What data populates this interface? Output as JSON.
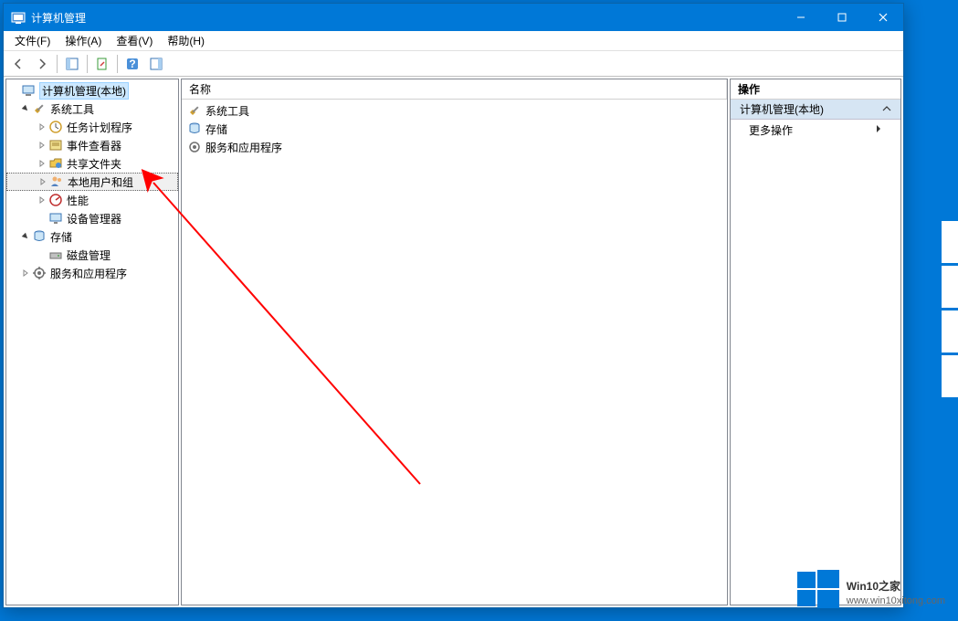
{
  "window": {
    "title": "计算机管理"
  },
  "menus": [
    "文件(F)",
    "操作(A)",
    "查看(V)",
    "帮助(H)"
  ],
  "tree": {
    "root": "计算机管理(本地)",
    "system_tools": {
      "label": "系统工具",
      "children": [
        "任务计划程序",
        "事件查看器",
        "共享文件夹",
        "本地用户和组",
        "性能",
        "设备管理器"
      ]
    },
    "storage": {
      "label": "存储",
      "children": [
        "磁盘管理"
      ]
    },
    "services": "服务和应用程序"
  },
  "center": {
    "header": "名称",
    "items": [
      "系统工具",
      "存储",
      "服务和应用程序"
    ]
  },
  "actions": {
    "header": "操作",
    "group": "计算机管理(本地)",
    "more": "更多操作"
  },
  "watermark": {
    "brand_main": "Win10",
    "brand_sub": "之家",
    "url": "www.win10xitong.com"
  }
}
